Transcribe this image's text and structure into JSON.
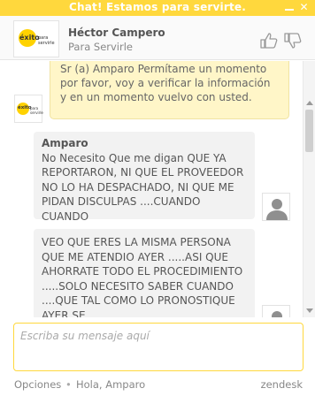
{
  "topbar": {
    "title": "Chat! Estamos para servirte.",
    "close_symbol": "✕"
  },
  "header": {
    "logo_word": "éxito",
    "logo_tagline": "para servirle",
    "agent_name": "Héctor Campero",
    "agent_subtitle": "Para Servirle"
  },
  "messages": [
    {
      "from": "agent",
      "text": "Sr (a) Amparo Permítame un momento por favor, voy a verificar la información y en un momento vuelvo con usted."
    },
    {
      "from": "user",
      "name": "Amparo",
      "text": "No Necesito Que me digan QUE YA REPORTARON, NI QUE EL PROVEEDOR NO LO HA DESPACHADO, NI QUE ME PIDAN DISCULPAS ....CUANDO CUANDO"
    },
    {
      "from": "user",
      "text": "VEO QUE ERES LA MISMA PERSONA QUE ME ATENDIO AYER .....ASI QUE AHORRATE TODO EL PROCEDIMIENTO .....SOLO NECESITO SABER CUANDO ....QUE TAL COMO LO PRONOSTIQUE AYER SE"
    }
  ],
  "composer": {
    "placeholder": "Escriba su mensaje aquí"
  },
  "footer": {
    "options_label": "Opciones",
    "separator": "•",
    "greeting": "Hola, Amparo",
    "brand": "zendesk"
  },
  "colors": {
    "accent": "#ffd83d",
    "agent_bubble": "#fff6c8",
    "user_bubble": "#f2f2f2"
  }
}
